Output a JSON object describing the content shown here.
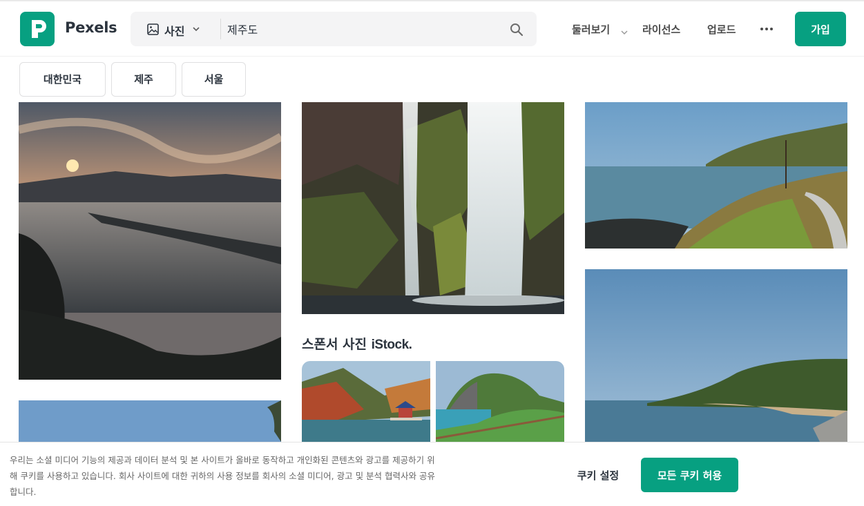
{
  "brand": {
    "name": "Pexels",
    "color": "#07a081"
  },
  "search": {
    "type_label": "사진",
    "type_icon": "image-icon",
    "value": "제주도",
    "placeholder": "",
    "icon": "search-icon"
  },
  "nav": {
    "explore": "둘러보기",
    "license": "라이선스",
    "upload": "업로드",
    "more_icon": "more-dots-icon",
    "join": "가입"
  },
  "chips": [
    "대한민국",
    "제주",
    "서울"
  ],
  "photos": [
    {
      "name": "jeju-sunset-coast"
    },
    {
      "name": "jeju-waterfall"
    },
    {
      "name": "jeju-coast-hill-path"
    },
    {
      "name": "jeju-sea-cliff"
    },
    {
      "name": "jeju-blue-sky"
    }
  ],
  "sponsor": {
    "label": "스폰서 사진",
    "brand": "iStock.",
    "photos": [
      {
        "name": "korea-autumn-pavilion"
      },
      {
        "name": "jeju-seongsan-peak"
      }
    ]
  },
  "cookie": {
    "text": "우리는 소셜 미디어 기능의 제공과 데이터 분석 및 본 사이트가 올바로 동작하고 개인화된 콘텐츠와 광고를 제공하기 위해 쿠키를 사용하고 있습니다. 회사 사이트에 대한 귀하의 사용 정보를 회사의 소셜 미디어, 광고 및 분석 협력사와 공유합니다.",
    "settings": "쿠키 설정",
    "accept": "모든 쿠키 허용"
  }
}
